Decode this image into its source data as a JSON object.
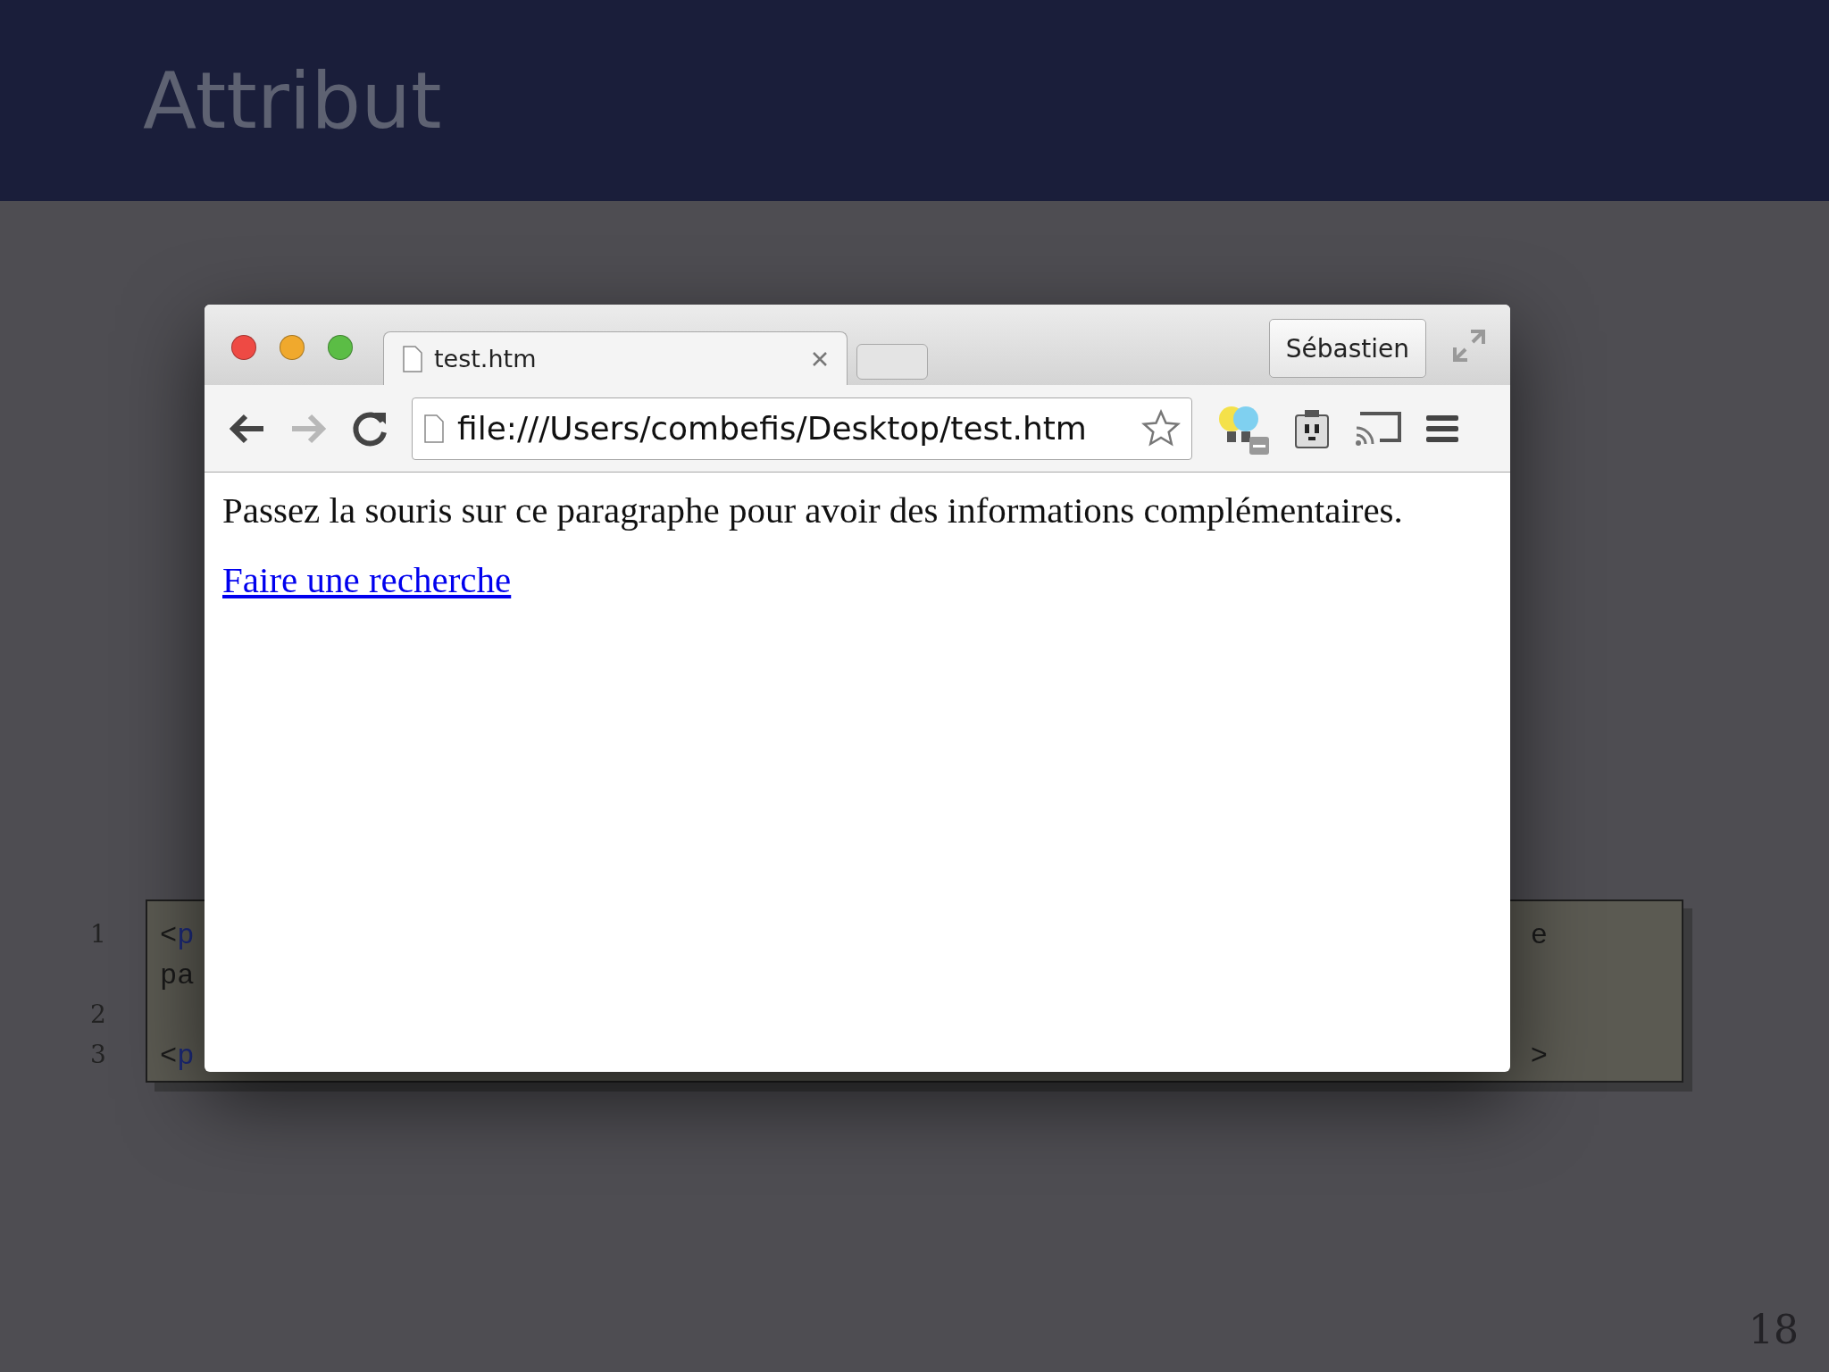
{
  "slide": {
    "title": "Attribut",
    "page_number": "18"
  },
  "code": {
    "lines": [
      {
        "kind": "line",
        "number": "1",
        "punct": "<",
        "tag": "p",
        "end": "e"
      },
      {
        "kind": "wrap",
        "text": "pa"
      },
      {
        "kind": "line",
        "number": "2"
      },
      {
        "kind": "line",
        "number": "3",
        "punct": "<",
        "tag": "p",
        "end": ">"
      }
    ]
  },
  "browser": {
    "tabs": [
      {
        "title": "test.htm",
        "selected": true
      }
    ],
    "profile": "Sébastien",
    "address": "file:///Users/combefis/Desktop/test.htm",
    "forward_disabled": true,
    "page": {
      "paragraph": "Passez la souris sur ce paragraphe pour avoir des informations complémentaires.",
      "link": "Faire une recherche"
    }
  }
}
